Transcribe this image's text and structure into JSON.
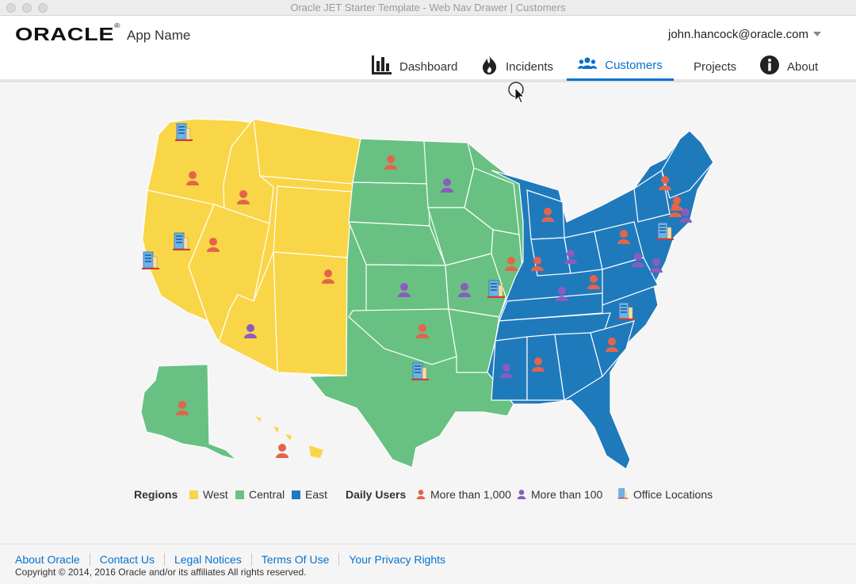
{
  "window": {
    "title": "Oracle JET Starter Template - Web Nav Drawer | Customers"
  },
  "header": {
    "logo_text": "ORACLE",
    "app_name": "App Name",
    "user": "john.hancock@oracle.com"
  },
  "nav": [
    {
      "label": "Dashboard",
      "icon": "bar-chart-icon"
    },
    {
      "label": "Incidents",
      "icon": "fire-icon"
    },
    {
      "label": "Customers",
      "icon": "people-icon",
      "active": true
    },
    {
      "label": "Projects",
      "icon": ""
    },
    {
      "label": "About",
      "icon": "info-icon"
    }
  ],
  "colors": {
    "accent": "#0572ce",
    "west": "#f9d648",
    "central": "#68c182",
    "east": "#1f7abc",
    "users_1000": "#e4644a",
    "users_100": "#8b5cc0"
  },
  "legend": {
    "regions_title": "Regions",
    "regions": [
      {
        "label": "West",
        "color": "#f9d648"
      },
      {
        "label": "Central",
        "color": "#68c182"
      },
      {
        "label": "East",
        "color": "#1f7abc"
      }
    ],
    "daily_users_title": "Daily Users",
    "markers": [
      {
        "label": "More than 1,000",
        "color": "#e4644a"
      },
      {
        "label": "More than 100",
        "color": "#8b5cc0"
      },
      {
        "label": "Office Locations",
        "icon": "office-building-icon"
      }
    ]
  },
  "footer": {
    "links": [
      "About Oracle",
      "Contact Us",
      "Legal Notices",
      "Terms Of Use",
      "Your Privacy Rights"
    ],
    "copyright": "Copyright © 2014, 2016 Oracle and/or its affiliates All rights reserved."
  }
}
